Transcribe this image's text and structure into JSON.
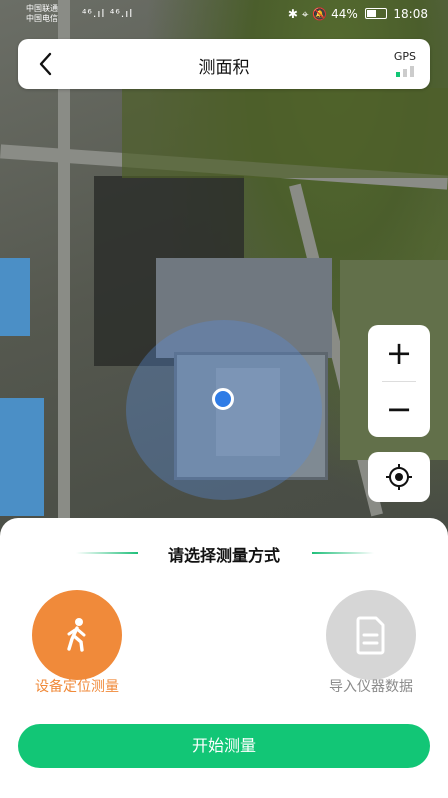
{
  "status": {
    "carrier1": "中国联通",
    "carrier2": "中国电信",
    "signals": "⁴⁶.ıl ⁴⁶.ıl",
    "right_icons": "✱ ⌖ 🔕",
    "battery": "44%",
    "time": "18:08"
  },
  "header": {
    "title": "测面积",
    "gps_label": "GPS"
  },
  "map": {
    "zoom_in": "+",
    "zoom_out": "−"
  },
  "panel": {
    "title": "请选择测量方式",
    "option_device": "设备定位测量",
    "option_import": "导入仪器数据",
    "start_button": "开始测量"
  },
  "colors": {
    "accent_green": "#12c676",
    "device_orange": "#f08a3a",
    "inactive_grey": "#d6d6d6"
  }
}
